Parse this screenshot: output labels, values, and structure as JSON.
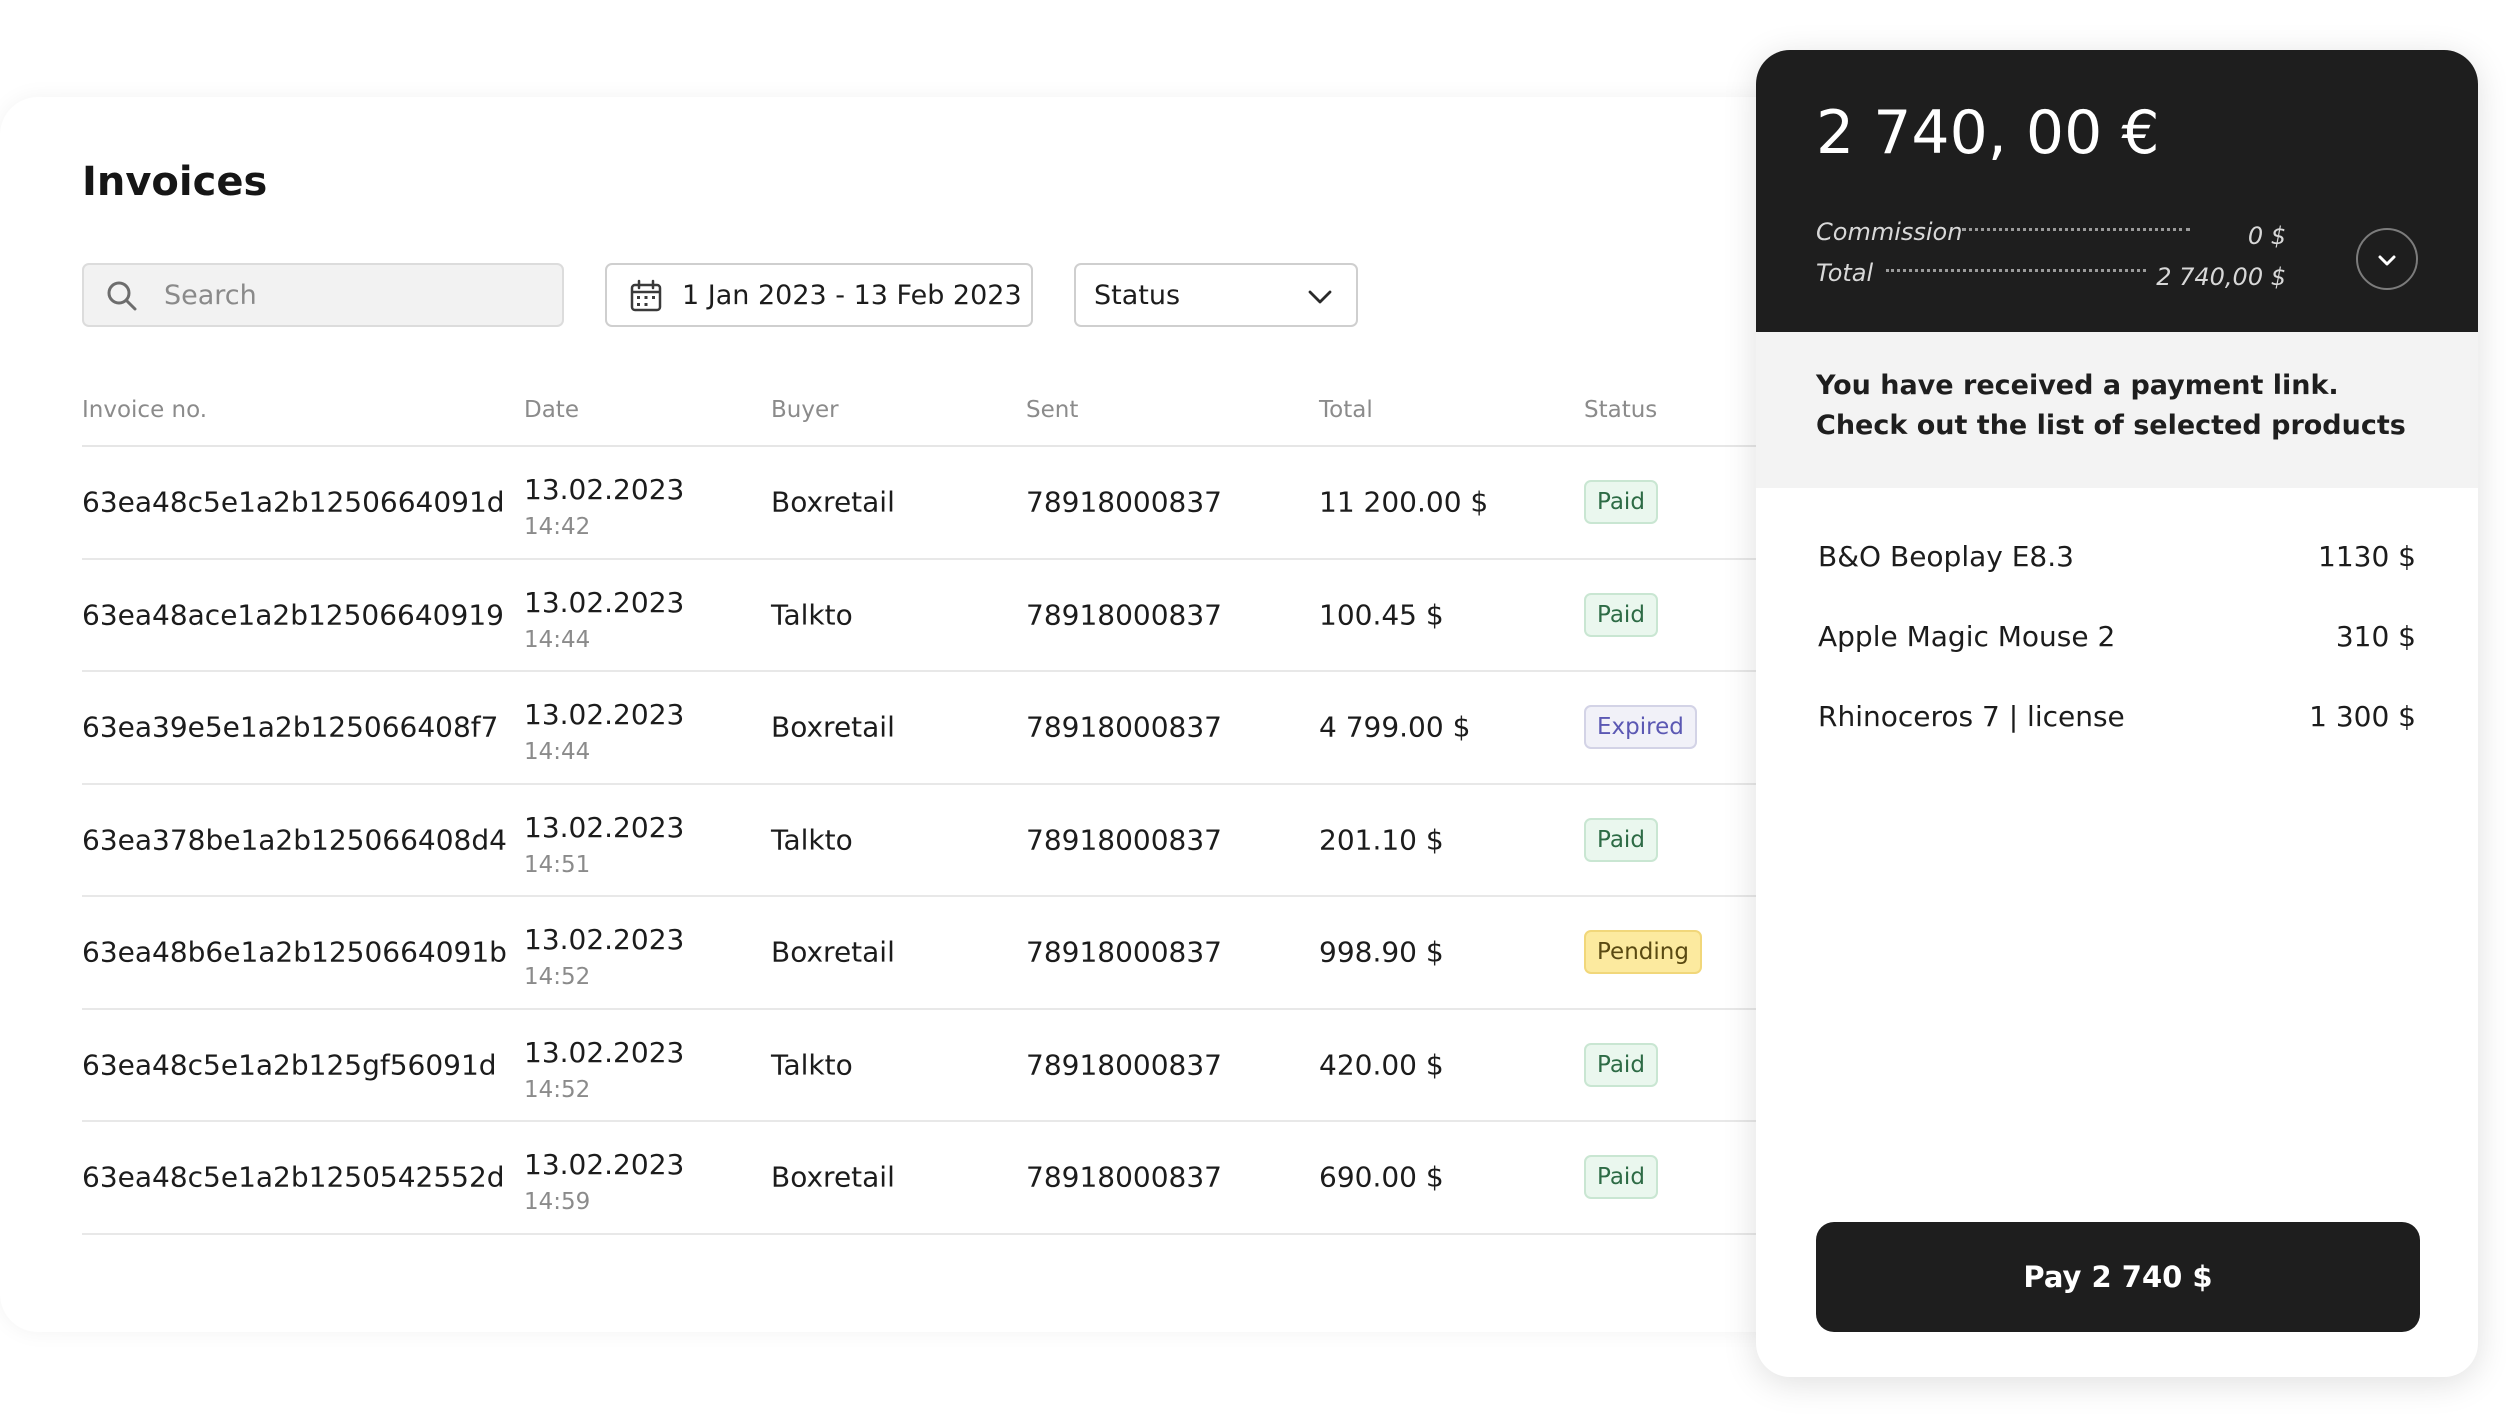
{
  "invoices": {
    "title": "Invoices",
    "search": {
      "placeholder": "Search",
      "value": ""
    },
    "date_range": {
      "label": "1 Jan 2023 - 13 Feb 2023"
    },
    "status_filter": {
      "label": "Status"
    },
    "columns": {
      "invoice_no": "Invoice no.",
      "date": "Date",
      "buyer": "Buyer",
      "sent": "Sent",
      "total": "Total",
      "status": "Status"
    },
    "rows": [
      {
        "id": "63ea48c5e1a2b1250664091d",
        "date": "13.02.2023",
        "time": "14:42",
        "buyer": "Boxretail",
        "sent": "78918000837",
        "total": "11 200.00 $",
        "status": "Paid",
        "status_type": "paid"
      },
      {
        "id": "63ea48ace1a2b12506640919",
        "date": "13.02.2023",
        "time": "14:44",
        "buyer": "Talkto",
        "sent": "78918000837",
        "total": "100.45 $",
        "status": "Paid",
        "status_type": "paid"
      },
      {
        "id": "63ea39e5e1a2b125066408f7",
        "date": "13.02.2023",
        "time": "14:44",
        "buyer": "Boxretail",
        "sent": "78918000837",
        "total": "4 799.00 $",
        "status": "Expired",
        "status_type": "expired"
      },
      {
        "id": "63ea378be1a2b125066408d4",
        "date": "13.02.2023",
        "time": "14:51",
        "buyer": "Talkto",
        "sent": "78918000837",
        "total": "201.10 $",
        "status": "Paid",
        "status_type": "paid"
      },
      {
        "id": "63ea48b6e1a2b1250664091b",
        "date": "13.02.2023",
        "time": "14:52",
        "buyer": "Boxretail",
        "sent": "78918000837",
        "total": "998.90 $",
        "status": "Pending",
        "status_type": "pending"
      },
      {
        "id": "63ea48c5e1a2b125gf56091d",
        "date": "13.02.2023",
        "time": "14:52",
        "buyer": "Talkto",
        "sent": "78918000837",
        "total": "420.00 $",
        "status": "Paid",
        "status_type": "paid"
      },
      {
        "id": "63ea48c5e1a2b1250542552d",
        "date": "13.02.2023",
        "time": "14:59",
        "buyer": "Boxretail",
        "sent": "78918000837",
        "total": "690.00 $",
        "status": "Paid",
        "status_type": "paid"
      }
    ]
  },
  "payment": {
    "amount": "2 740, 00 €",
    "commission_label": "Commission",
    "commission_value": "0  $",
    "total_label": "Total",
    "total_value": "2 740,00 $",
    "notice_line1": "You have received a payment link.",
    "notice_line2": "Check out the list of selected products",
    "products": [
      {
        "name": "B&O Beoplay E8.3",
        "price": "1130 $"
      },
      {
        "name": "Apple Magic Mouse 2",
        "price": "310 $"
      },
      {
        "name": "Rhinoceros 7 | license",
        "price": "1 300 $"
      }
    ],
    "pay_label": "Pay 2 740 $"
  },
  "icons": {
    "search": "search-icon",
    "calendar": "calendar-icon",
    "status_dropdown": "chevron-down-icon",
    "expand": "chevron-down-icon"
  },
  "colors": {
    "panel_dark": "#1e1e1e",
    "paid_bg": "#eaf7ee",
    "expired_bg": "#f1f1f8",
    "pending_bg": "#fcea9f"
  }
}
